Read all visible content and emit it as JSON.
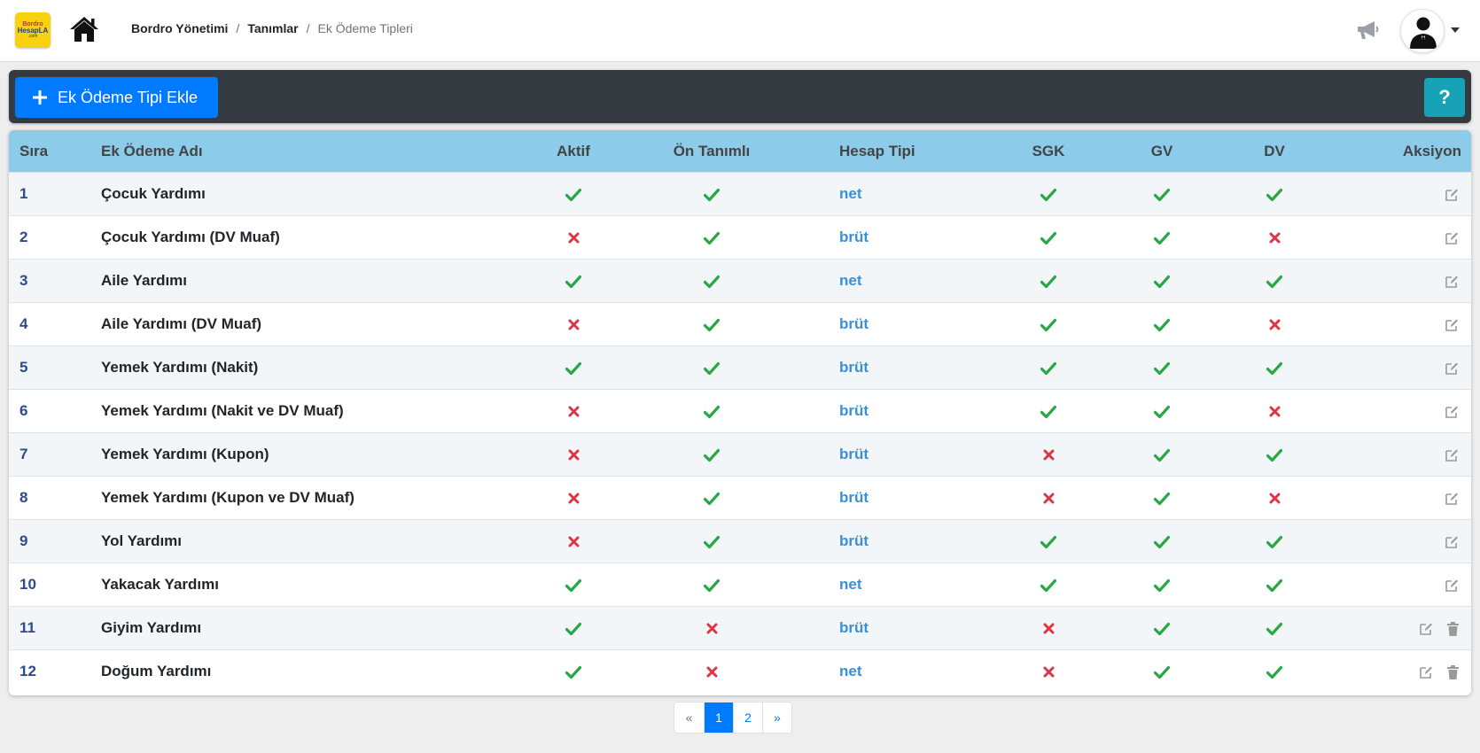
{
  "logo": {
    "line1": "Bordro",
    "line2": "HesapLA",
    "line3": ".com"
  },
  "breadcrumb": {
    "items": [
      "Bordro Yönetimi",
      "Tanımlar"
    ],
    "current": "Ek Ödeme Tipleri",
    "separator": "/"
  },
  "toolbar": {
    "add_label": "Ek Ödeme Tipi Ekle",
    "help_label": "?"
  },
  "table": {
    "headers": [
      "Sıra",
      "Ek Ödeme Adı",
      "Aktif",
      "Ön Tanımlı",
      "Hesap Tipi",
      "SGK",
      "GV",
      "DV",
      "Aksiyon"
    ],
    "rows": [
      {
        "sira": "1",
        "name": "Çocuk Yardımı",
        "aktif": true,
        "on_tanimli": true,
        "hesap": "net",
        "sgk": true,
        "gv": true,
        "dv": true,
        "deletable": false
      },
      {
        "sira": "2",
        "name": "Çocuk Yardımı (DV Muaf)",
        "aktif": false,
        "on_tanimli": true,
        "hesap": "brüt",
        "sgk": true,
        "gv": true,
        "dv": false,
        "deletable": false
      },
      {
        "sira": "3",
        "name": "Aile Yardımı",
        "aktif": true,
        "on_tanimli": true,
        "hesap": "net",
        "sgk": true,
        "gv": true,
        "dv": true,
        "deletable": false
      },
      {
        "sira": "4",
        "name": "Aile Yardımı (DV Muaf)",
        "aktif": false,
        "on_tanimli": true,
        "hesap": "brüt",
        "sgk": true,
        "gv": true,
        "dv": false,
        "deletable": false
      },
      {
        "sira": "5",
        "name": "Yemek Yardımı (Nakit)",
        "aktif": true,
        "on_tanimli": true,
        "hesap": "brüt",
        "sgk": true,
        "gv": true,
        "dv": true,
        "deletable": false
      },
      {
        "sira": "6",
        "name": "Yemek Yardımı (Nakit ve DV Muaf)",
        "aktif": false,
        "on_tanimli": true,
        "hesap": "brüt",
        "sgk": true,
        "gv": true,
        "dv": false,
        "deletable": false
      },
      {
        "sira": "7",
        "name": "Yemek Yardımı (Kupon)",
        "aktif": false,
        "on_tanimli": true,
        "hesap": "brüt",
        "sgk": false,
        "gv": true,
        "dv": true,
        "deletable": false
      },
      {
        "sira": "8",
        "name": "Yemek Yardımı (Kupon ve DV Muaf)",
        "aktif": false,
        "on_tanimli": true,
        "hesap": "brüt",
        "sgk": false,
        "gv": true,
        "dv": false,
        "deletable": false
      },
      {
        "sira": "9",
        "name": "Yol Yardımı",
        "aktif": false,
        "on_tanimli": true,
        "hesap": "brüt",
        "sgk": true,
        "gv": true,
        "dv": true,
        "deletable": false
      },
      {
        "sira": "10",
        "name": "Yakacak Yardımı",
        "aktif": true,
        "on_tanimli": true,
        "hesap": "net",
        "sgk": true,
        "gv": true,
        "dv": true,
        "deletable": false
      },
      {
        "sira": "11",
        "name": "Giyim Yardımı",
        "aktif": true,
        "on_tanimli": false,
        "hesap": "brüt",
        "sgk": false,
        "gv": true,
        "dv": true,
        "deletable": true
      },
      {
        "sira": "12",
        "name": "Doğum Yardımı",
        "aktif": true,
        "on_tanimli": false,
        "hesap": "net",
        "sgk": false,
        "gv": true,
        "dv": true,
        "deletable": true
      }
    ]
  },
  "pagination": {
    "prev": "«",
    "pages": [
      "1",
      "2"
    ],
    "current": "1",
    "next": "»"
  },
  "colors": {
    "check": "#28a745",
    "cross": "#dc3545",
    "icon_muted": "#9a9a9a",
    "header_bg": "#8ccbea",
    "toolbar_bg": "#343a40",
    "primary": "#007bff",
    "info": "#17a2b8"
  },
  "icons": {
    "home": "home-icon",
    "megaphone": "megaphone-icon",
    "avatar": "user-tie-icon",
    "add": "plus-icon",
    "ok": "check-icon",
    "no": "cross-icon",
    "edit": "edit-icon",
    "delete": "trash-icon"
  }
}
